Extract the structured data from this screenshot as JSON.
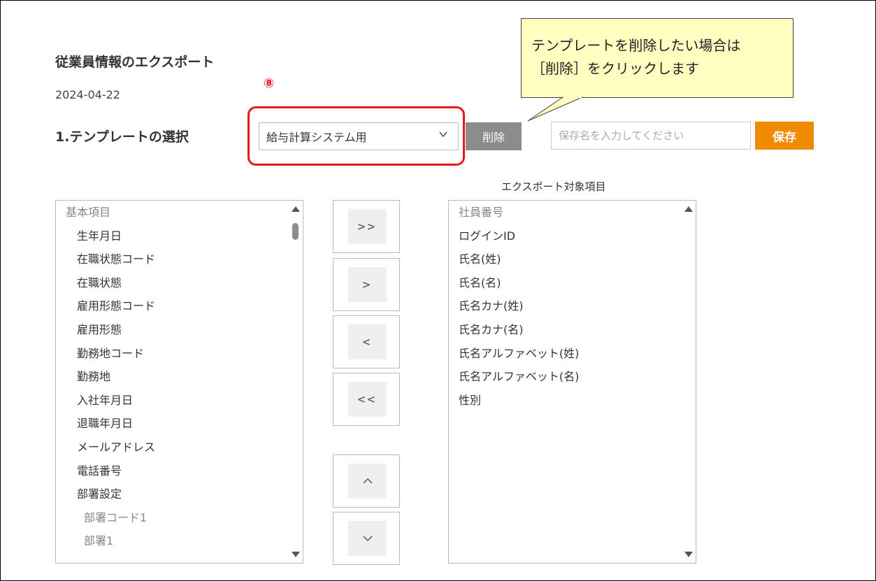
{
  "header": {
    "title": "従業員情報のエクスポート",
    "date": "2024-04-22"
  },
  "annotation": {
    "step_marker": "⑧",
    "callout_line1": "テンプレートを削除したい場合は",
    "callout_line2": "［削除］をクリックします"
  },
  "template": {
    "section_title": "1.テンプレートの選択",
    "selected": "給与計算システム用",
    "delete_label": "削除",
    "save_placeholder": "保存名を入力してください",
    "save_label": "保存"
  },
  "export": {
    "target_label": "エクスポート対象項目"
  },
  "available_items": [
    {
      "label": "基本項目",
      "level": 0
    },
    {
      "label": "生年月日",
      "level": 1
    },
    {
      "label": "在職状態コード",
      "level": 1
    },
    {
      "label": "在職状態",
      "level": 1
    },
    {
      "label": "雇用形態コード",
      "level": 1
    },
    {
      "label": "雇用形態",
      "level": 1
    },
    {
      "label": "勤務地コード",
      "level": 1
    },
    {
      "label": "勤務地",
      "level": 1
    },
    {
      "label": "入社年月日",
      "level": 1
    },
    {
      "label": "退職年月日",
      "level": 1
    },
    {
      "label": "メールアドレス",
      "level": 1
    },
    {
      "label": "電話番号",
      "level": 1
    },
    {
      "label": "部署設定",
      "level": 1
    },
    {
      "label": "部署コード1",
      "level": 2
    },
    {
      "label": "部署1",
      "level": 2
    }
  ],
  "selected_items": [
    "社員番号",
    "ログインID",
    "氏名(姓)",
    "氏名(名)",
    "氏名カナ(姓)",
    "氏名カナ(名)",
    "氏名アルファベット(姓)",
    "氏名アルファベット(名)",
    "性別"
  ],
  "move_buttons": {
    "add_all": ">>",
    "add": ">",
    "remove": "<",
    "remove_all": "<<",
    "up_icon": "chevron-up-icon",
    "down_icon": "chevron-down-icon"
  },
  "colors": {
    "highlight": "#e8191e",
    "save_button": "#f08a00",
    "delete_button": "#8c8c8c",
    "callout_bg": "#ffffc2"
  }
}
